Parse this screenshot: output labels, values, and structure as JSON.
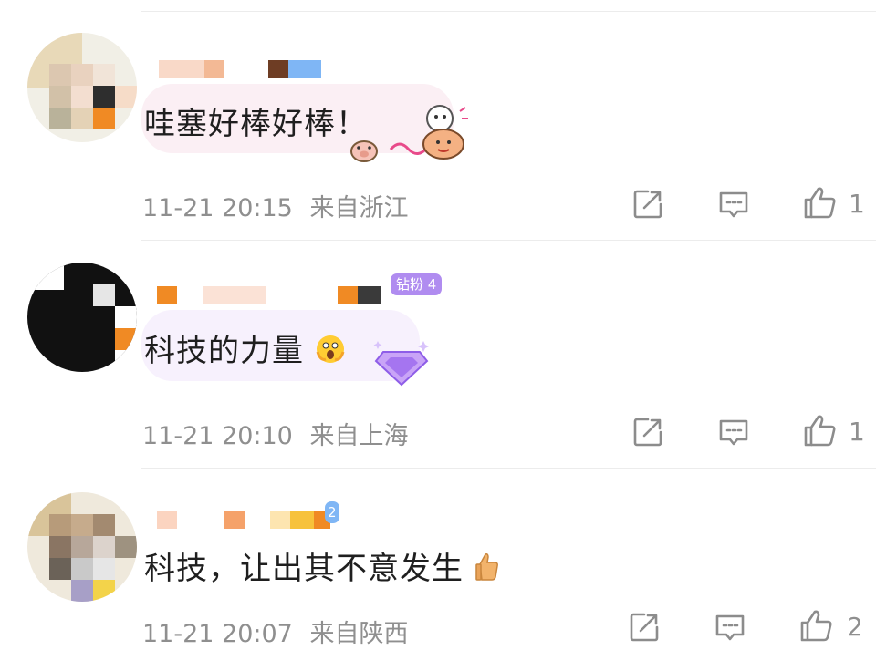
{
  "comments": [
    {
      "text": "哇塞好棒好棒！",
      "time": "11-21 20:15",
      "location": "来自浙江",
      "likes": "1",
      "inline_emoji": []
    },
    {
      "text": "科技的力量",
      "time": "11-21 20:10",
      "location": "来自上海",
      "likes": "1",
      "badge": "钻粉 4",
      "inline_emoji": [
        "shocked-face-emoji"
      ]
    },
    {
      "text": "科技，让出其不意发生",
      "time": "11-21 20:07",
      "location": "来自陕西",
      "likes": "2",
      "badge": "2",
      "inline_emoji": [
        "thumbs-up-emoji"
      ]
    }
  ],
  "colors": {
    "text": "#1f1f1f",
    "meta": "#8f8f8f",
    "icon": "#8c8c8c",
    "badge_purple": "#b08cf0",
    "badge_blue": "#7fb6f5"
  },
  "icons": {
    "share": "share-icon",
    "comment": "comment-icon",
    "like": "like-icon"
  }
}
